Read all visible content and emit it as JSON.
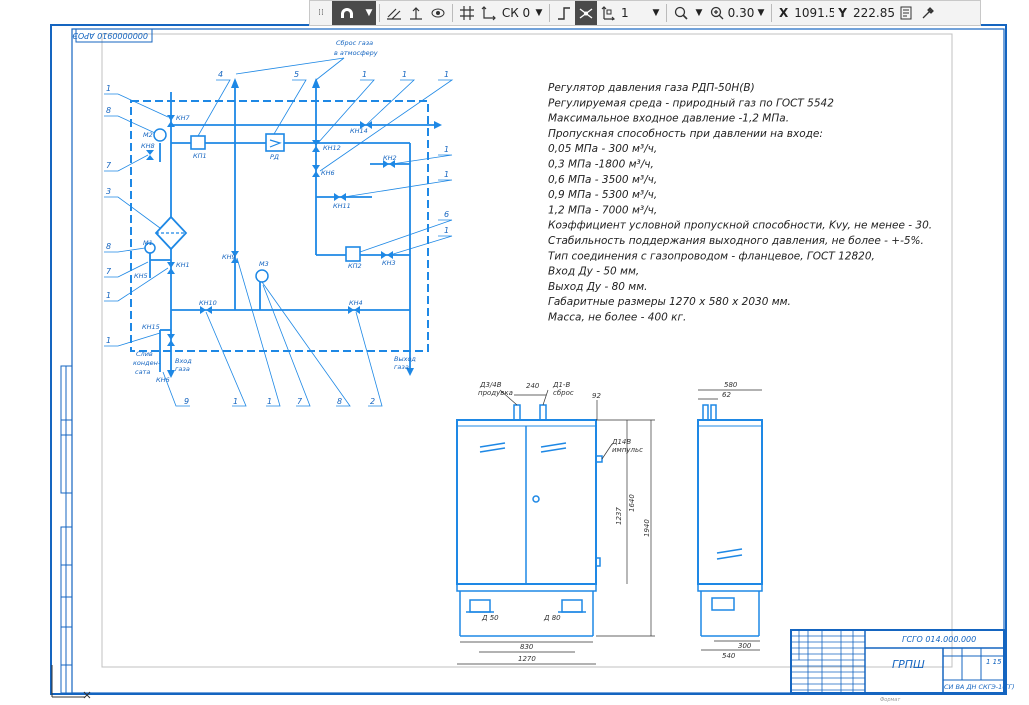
{
  "toolbar": {
    "layer_value": "СК 0",
    "line_style_value": "1",
    "zoom_value": "0.30",
    "x_label": "X",
    "x_value": "1091.5",
    "y_label": "Y",
    "y_value": "222.859"
  },
  "drawing": {
    "doc_number_rotated": "0000000910 АРОЭ",
    "spec": {
      "lines": [
        "Регулятор давления газа РДП-50Н(В)",
        "Регулируемая среда - природный газ по ГОСТ 5542",
        "Максимальное входное давление -1,2 МПа.",
        "Пропускная способность при давлении на входе:",
        "0,05 МПа - 300 м³/ч,",
        "0,3 МПа -1800 м³/ч,",
        "0,6 МПа - 3500 м³/ч,",
        "0,9 МПа - 5300 м³/ч,",
        "1,2 МПа - 7000 м³/ч,",
        "Коэффициент условной пропускной способности, Kvy, не менее - 30.",
        "Стабильность поддержания выходного давления, не более - +-5%.",
        "Тип соединения с газопроводом - фланцевое, ГОСТ 12820,",
        "Вход Ду - 50 мм,",
        "Выход Ду - 80 мм.",
        "Габаритные размеры 1270 х 580 х 2030 мм.",
        "Масса, не более - 400 кг."
      ]
    },
    "schematic": {
      "labels": {
        "vent": "Сброс газа",
        "vent2": "в атмосферу",
        "inlet": "Вход",
        "inlet2": "газа",
        "outlet": "Выход",
        "outlet2": "газа",
        "drain": "Слив",
        "drain2": "конден-",
        "drain3": "сата",
        "kn7": "КН7",
        "kn8": "КН8",
        "kn4": "КН4",
        "kn1": "КН1",
        "kn5": "КН5",
        "kn2": "КН2",
        "kn3": "КН3",
        "kn6": "КН6",
        "kn9": "КН9",
        "kn10": "КН10",
        "kn11": "КН11",
        "kn12": "КН12",
        "kn14": "КН14",
        "kn15": "КН15",
        "kp1": "КП1",
        "kp2": "КП2",
        "rd": "РД",
        "m1": "М1",
        "m2": "М2",
        "m3": "М3",
        "kn6b": "КН6"
      },
      "callouts": [
        "1",
        "4",
        "5",
        "1",
        "1",
        "8",
        "7",
        "3",
        "8",
        "7",
        "1",
        "1",
        "1",
        "1",
        "6",
        "1",
        "9",
        "1",
        "1",
        "7",
        "8",
        "2",
        "1"
      ]
    },
    "views": {
      "dims": {
        "d_in": "Д3/4В",
        "d_in2": "продувка",
        "d_240": "240",
        "d_vent": "Д1-В",
        "d_vent2": "сброс",
        "d_92": "92",
        "d_imp": "Д14В",
        "d_imp2": "импульс",
        "d_1940": "1940",
        "d_1640": "1640",
        "d_1237": "1237",
        "d_50": "Д 50",
        "d_80": "Д 80",
        "d_830": "830",
        "d_1270": "1270",
        "d_580": "580",
        "d_62": "62",
        "d_300": "300",
        "d_540": "540"
      }
    },
    "title_block": {
      "code": "ГСГО 014.000.000",
      "name": "ГРПШ",
      "sheet": "1 15",
      "org": "СИ ВА ДН СКГЭ-1(ГГ)",
      "misc": "Формат"
    }
  }
}
